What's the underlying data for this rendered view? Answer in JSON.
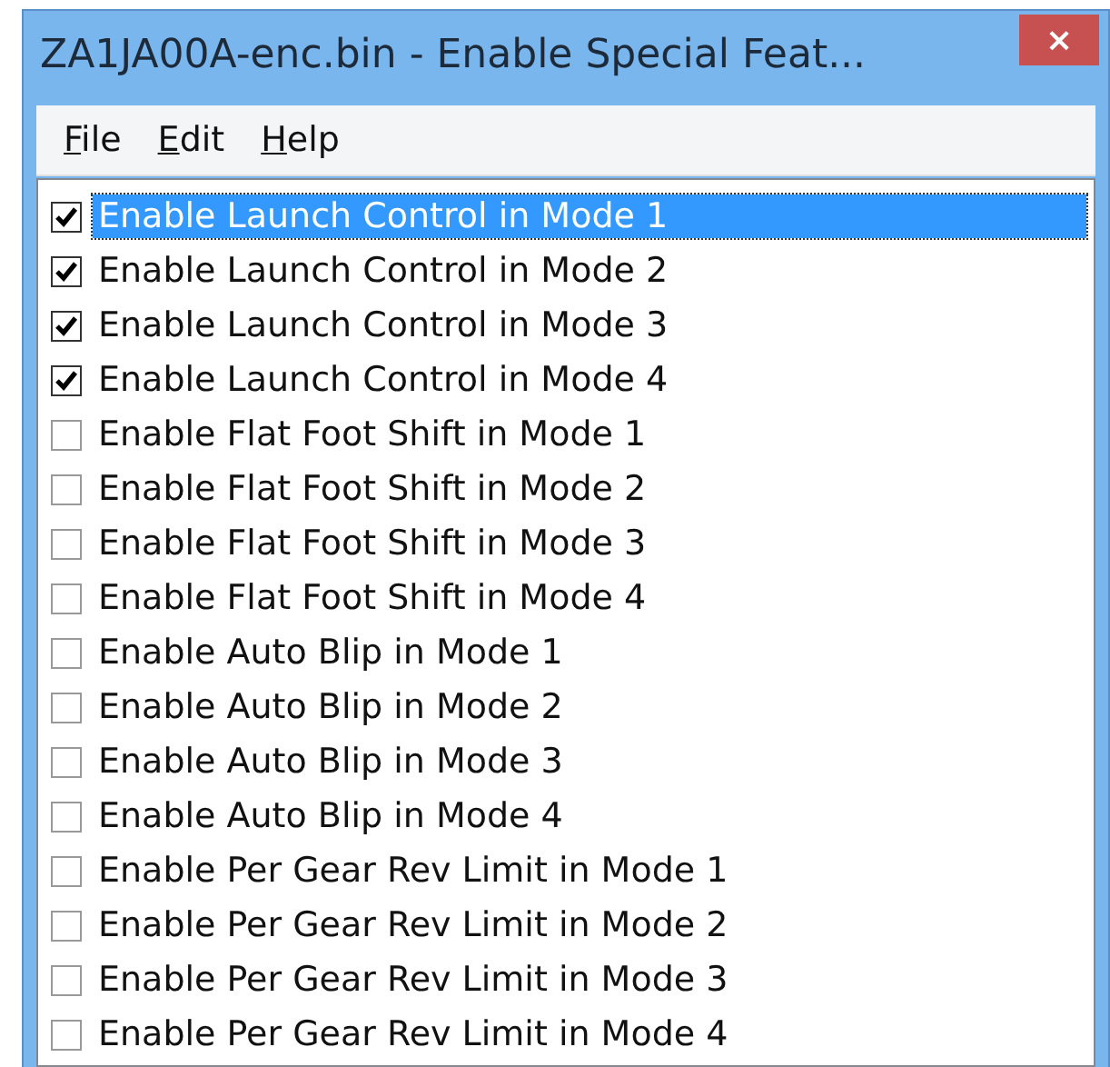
{
  "window": {
    "title": "ZA1JA00A-enc.bin - Enable Special Feat...",
    "close": "×"
  },
  "menu": [
    {
      "label": "File"
    },
    {
      "label": "Edit"
    },
    {
      "label": "Help"
    }
  ],
  "options": [
    {
      "label": "Enable Launch Control in Mode 1",
      "checked": true,
      "selected": true
    },
    {
      "label": "Enable Launch Control in Mode 2",
      "checked": true,
      "selected": false
    },
    {
      "label": "Enable Launch Control in Mode 3",
      "checked": true,
      "selected": false
    },
    {
      "label": "Enable Launch Control in Mode 4",
      "checked": true,
      "selected": false
    },
    {
      "label": "Enable Flat Foot Shift in Mode 1",
      "checked": false,
      "selected": false
    },
    {
      "label": "Enable Flat Foot Shift in Mode 2",
      "checked": false,
      "selected": false
    },
    {
      "label": "Enable Flat Foot Shift in Mode 3",
      "checked": false,
      "selected": false
    },
    {
      "label": "Enable Flat Foot Shift in Mode 4",
      "checked": false,
      "selected": false
    },
    {
      "label": "Enable Auto Blip in Mode 1",
      "checked": false,
      "selected": false
    },
    {
      "label": "Enable Auto Blip in Mode 2",
      "checked": false,
      "selected": false
    },
    {
      "label": "Enable Auto Blip in Mode 3",
      "checked": false,
      "selected": false
    },
    {
      "label": "Enable Auto Blip in Mode 4",
      "checked": false,
      "selected": false
    },
    {
      "label": "Enable Per Gear Rev Limit in Mode 1",
      "checked": false,
      "selected": false
    },
    {
      "label": "Enable Per Gear Rev Limit in Mode 2",
      "checked": false,
      "selected": false
    },
    {
      "label": "Enable Per Gear Rev Limit in Mode 3",
      "checked": false,
      "selected": false
    },
    {
      "label": "Enable Per Gear Rev Limit in Mode 4",
      "checked": false,
      "selected": false
    }
  ]
}
